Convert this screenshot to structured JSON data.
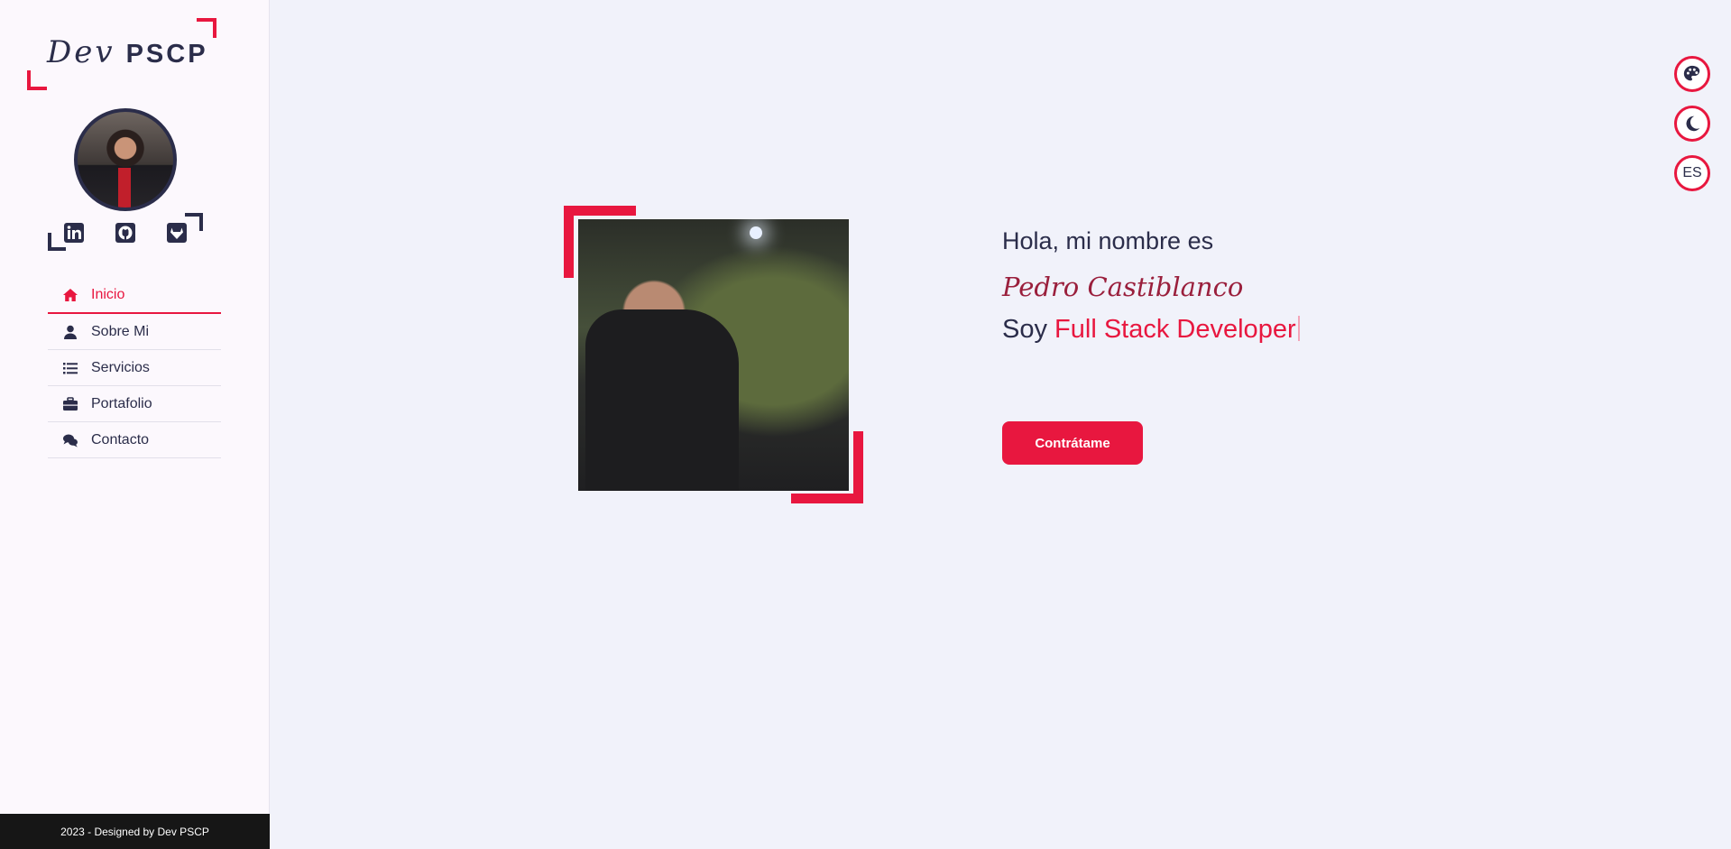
{
  "logo": {
    "script": "Dev",
    "bold": "PSCP"
  },
  "social": [
    {
      "name": "linkedin-icon"
    },
    {
      "name": "github-icon"
    },
    {
      "name": "gitlab-icon"
    }
  ],
  "nav": [
    {
      "label": "Inicio",
      "icon": "home-icon",
      "active": true
    },
    {
      "label": "Sobre Mi",
      "icon": "user-icon",
      "active": false
    },
    {
      "label": "Servicios",
      "icon": "list-icon",
      "active": false
    },
    {
      "label": "Portafolio",
      "icon": "briefcase-icon",
      "active": false
    },
    {
      "label": "Contacto",
      "icon": "comments-icon",
      "active": false
    }
  ],
  "footer": {
    "text": "2023 - Designed by Dev PSCP"
  },
  "hero": {
    "greeting": "Hola, mi nombre es",
    "name": "Pedro Castiblanco",
    "role_prefix": "Soy",
    "role_value": "Full Stack Developer",
    "cta_label": "Contrátame"
  },
  "controls": {
    "language": "ES"
  },
  "colors": {
    "accent": "#e8173f",
    "text": "#2b2d4a",
    "sidebar_bg": "#fcf8fd",
    "main_bg": "#f1f2fa"
  }
}
